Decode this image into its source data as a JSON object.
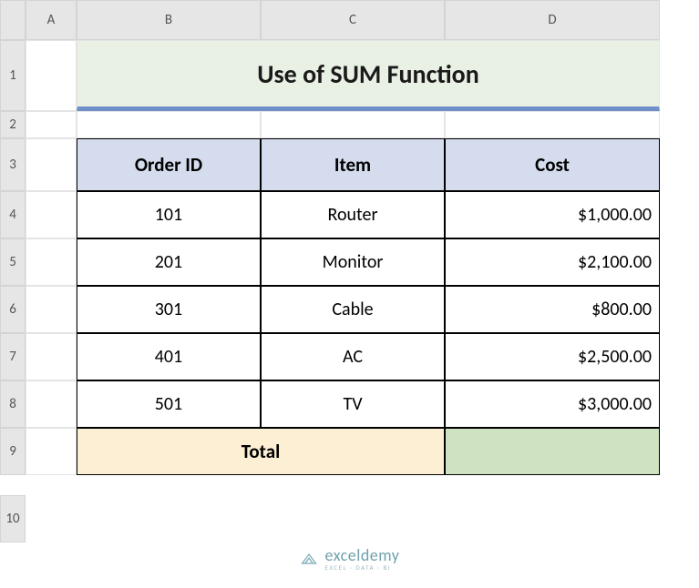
{
  "colHeaders": [
    "A",
    "B",
    "C",
    "D"
  ],
  "rowHeaders": [
    "1",
    "2",
    "3",
    "4",
    "5",
    "6",
    "7",
    "8",
    "9",
    "10"
  ],
  "title": "Use of SUM Function",
  "tableHeaders": {
    "a": "Order ID",
    "b": "Item",
    "c": "Cost"
  },
  "rows": [
    {
      "id": "101",
      "item": "Router",
      "cost": "$1,000.00"
    },
    {
      "id": "201",
      "item": "Monitor",
      "cost": "$2,100.00"
    },
    {
      "id": "301",
      "item": "Cable",
      "cost": "$800.00"
    },
    {
      "id": "401",
      "item": "AC",
      "cost": "$2,500.00"
    },
    {
      "id": "501",
      "item": "TV",
      "cost": "$3,000.00"
    }
  ],
  "totalLabel": "Total",
  "totalValue": "",
  "logo": {
    "name": "exceldemy",
    "sub": "EXCEL · DATA · BI"
  },
  "chart_data": {
    "type": "table",
    "title": "Use of SUM Function",
    "columns": [
      "Order ID",
      "Item",
      "Cost"
    ],
    "rows": [
      [
        101,
        "Router",
        1000.0
      ],
      [
        201,
        "Monitor",
        2100.0
      ],
      [
        301,
        "Cable",
        800.0
      ],
      [
        401,
        "AC",
        2500.0
      ],
      [
        501,
        "TV",
        3000.0
      ]
    ],
    "total": null
  }
}
